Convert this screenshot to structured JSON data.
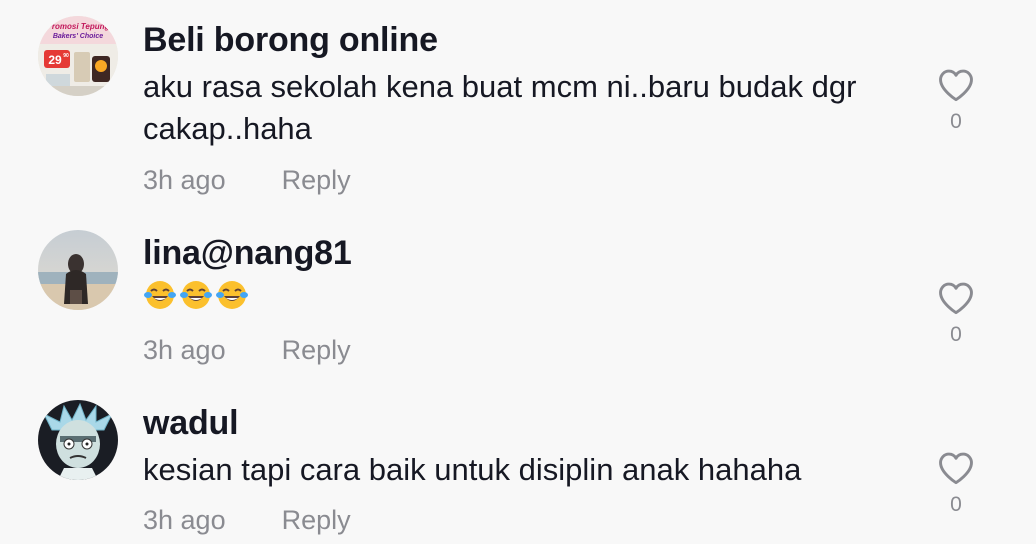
{
  "comments": [
    {
      "username": "Beli borong online",
      "text": "aku rasa sekolah kena buat mcm ni..baru budak dgr cakap..haha",
      "time": "3h ago",
      "reply_label": "Reply",
      "likes": "0",
      "avatar": {
        "promo_line1": "Promosi Tepung",
        "promo_line2": "Bakers' Choice",
        "price": "29",
        "price_cents": "90"
      }
    },
    {
      "username": "lina@nang81",
      "text": "",
      "emoji": "face-with-tears-of-joy",
      "emoji_count": 3,
      "time": "3h ago",
      "reply_label": "Reply",
      "likes": "0"
    },
    {
      "username": "wadul",
      "text": "kesian tapi cara baik untuk disiplin anak hahaha",
      "time": "3h ago",
      "reply_label": "Reply",
      "likes": "0"
    }
  ],
  "colors": {
    "background": "#f8f8f8",
    "username": "#161823",
    "text": "#161823",
    "meta": "#8a8b91",
    "heart_outline": "#8a8b91"
  },
  "icons": {
    "like": "heart-outline-icon",
    "emoji": "laughing-tears-emoji-icon"
  }
}
